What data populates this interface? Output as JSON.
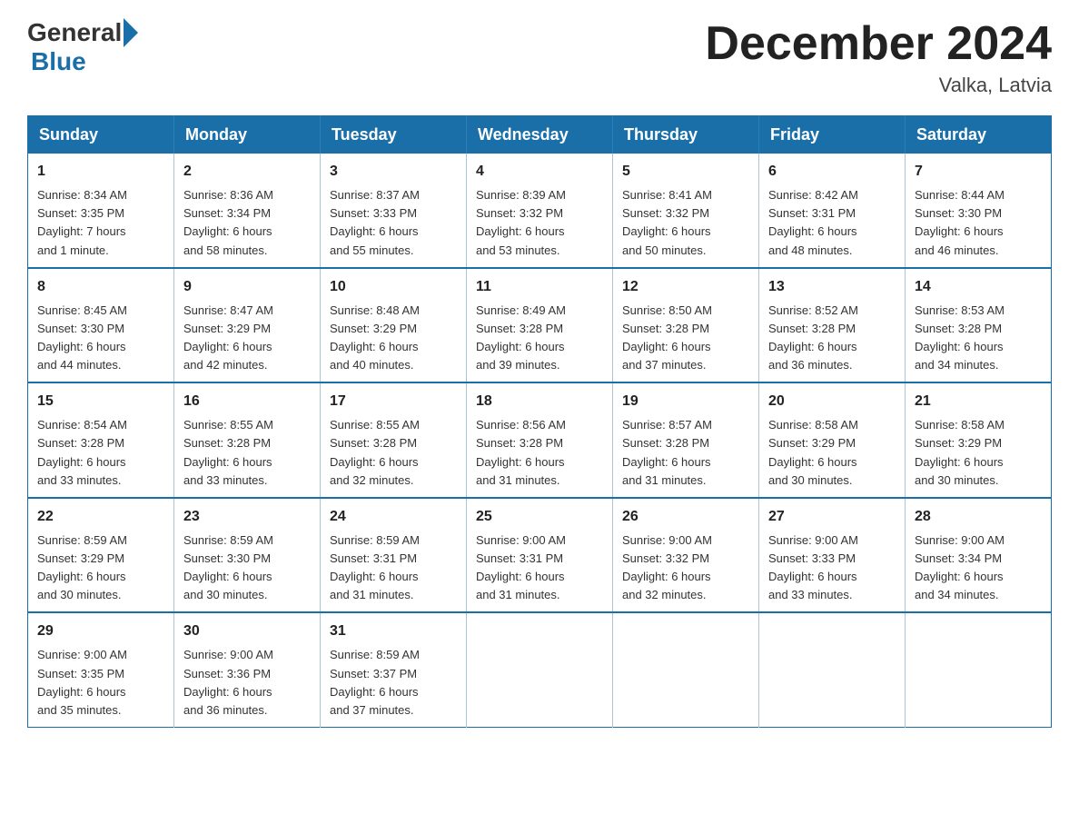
{
  "header": {
    "logo_general": "General",
    "logo_blue": "Blue",
    "month_title": "December 2024",
    "location": "Valka, Latvia"
  },
  "calendar": {
    "days_of_week": [
      "Sunday",
      "Monday",
      "Tuesday",
      "Wednesday",
      "Thursday",
      "Friday",
      "Saturday"
    ],
    "weeks": [
      [
        {
          "day": "1",
          "info": "Sunrise: 8:34 AM\nSunset: 3:35 PM\nDaylight: 7 hours\nand 1 minute."
        },
        {
          "day": "2",
          "info": "Sunrise: 8:36 AM\nSunset: 3:34 PM\nDaylight: 6 hours\nand 58 minutes."
        },
        {
          "day": "3",
          "info": "Sunrise: 8:37 AM\nSunset: 3:33 PM\nDaylight: 6 hours\nand 55 minutes."
        },
        {
          "day": "4",
          "info": "Sunrise: 8:39 AM\nSunset: 3:32 PM\nDaylight: 6 hours\nand 53 minutes."
        },
        {
          "day": "5",
          "info": "Sunrise: 8:41 AM\nSunset: 3:32 PM\nDaylight: 6 hours\nand 50 minutes."
        },
        {
          "day": "6",
          "info": "Sunrise: 8:42 AM\nSunset: 3:31 PM\nDaylight: 6 hours\nand 48 minutes."
        },
        {
          "day": "7",
          "info": "Sunrise: 8:44 AM\nSunset: 3:30 PM\nDaylight: 6 hours\nand 46 minutes."
        }
      ],
      [
        {
          "day": "8",
          "info": "Sunrise: 8:45 AM\nSunset: 3:30 PM\nDaylight: 6 hours\nand 44 minutes."
        },
        {
          "day": "9",
          "info": "Sunrise: 8:47 AM\nSunset: 3:29 PM\nDaylight: 6 hours\nand 42 minutes."
        },
        {
          "day": "10",
          "info": "Sunrise: 8:48 AM\nSunset: 3:29 PM\nDaylight: 6 hours\nand 40 minutes."
        },
        {
          "day": "11",
          "info": "Sunrise: 8:49 AM\nSunset: 3:28 PM\nDaylight: 6 hours\nand 39 minutes."
        },
        {
          "day": "12",
          "info": "Sunrise: 8:50 AM\nSunset: 3:28 PM\nDaylight: 6 hours\nand 37 minutes."
        },
        {
          "day": "13",
          "info": "Sunrise: 8:52 AM\nSunset: 3:28 PM\nDaylight: 6 hours\nand 36 minutes."
        },
        {
          "day": "14",
          "info": "Sunrise: 8:53 AM\nSunset: 3:28 PM\nDaylight: 6 hours\nand 34 minutes."
        }
      ],
      [
        {
          "day": "15",
          "info": "Sunrise: 8:54 AM\nSunset: 3:28 PM\nDaylight: 6 hours\nand 33 minutes."
        },
        {
          "day": "16",
          "info": "Sunrise: 8:55 AM\nSunset: 3:28 PM\nDaylight: 6 hours\nand 33 minutes."
        },
        {
          "day": "17",
          "info": "Sunrise: 8:55 AM\nSunset: 3:28 PM\nDaylight: 6 hours\nand 32 minutes."
        },
        {
          "day": "18",
          "info": "Sunrise: 8:56 AM\nSunset: 3:28 PM\nDaylight: 6 hours\nand 31 minutes."
        },
        {
          "day": "19",
          "info": "Sunrise: 8:57 AM\nSunset: 3:28 PM\nDaylight: 6 hours\nand 31 minutes."
        },
        {
          "day": "20",
          "info": "Sunrise: 8:58 AM\nSunset: 3:29 PM\nDaylight: 6 hours\nand 30 minutes."
        },
        {
          "day": "21",
          "info": "Sunrise: 8:58 AM\nSunset: 3:29 PM\nDaylight: 6 hours\nand 30 minutes."
        }
      ],
      [
        {
          "day": "22",
          "info": "Sunrise: 8:59 AM\nSunset: 3:29 PM\nDaylight: 6 hours\nand 30 minutes."
        },
        {
          "day": "23",
          "info": "Sunrise: 8:59 AM\nSunset: 3:30 PM\nDaylight: 6 hours\nand 30 minutes."
        },
        {
          "day": "24",
          "info": "Sunrise: 8:59 AM\nSunset: 3:31 PM\nDaylight: 6 hours\nand 31 minutes."
        },
        {
          "day": "25",
          "info": "Sunrise: 9:00 AM\nSunset: 3:31 PM\nDaylight: 6 hours\nand 31 minutes."
        },
        {
          "day": "26",
          "info": "Sunrise: 9:00 AM\nSunset: 3:32 PM\nDaylight: 6 hours\nand 32 minutes."
        },
        {
          "day": "27",
          "info": "Sunrise: 9:00 AM\nSunset: 3:33 PM\nDaylight: 6 hours\nand 33 minutes."
        },
        {
          "day": "28",
          "info": "Sunrise: 9:00 AM\nSunset: 3:34 PM\nDaylight: 6 hours\nand 34 minutes."
        }
      ],
      [
        {
          "day": "29",
          "info": "Sunrise: 9:00 AM\nSunset: 3:35 PM\nDaylight: 6 hours\nand 35 minutes."
        },
        {
          "day": "30",
          "info": "Sunrise: 9:00 AM\nSunset: 3:36 PM\nDaylight: 6 hours\nand 36 minutes."
        },
        {
          "day": "31",
          "info": "Sunrise: 8:59 AM\nSunset: 3:37 PM\nDaylight: 6 hours\nand 37 minutes."
        },
        {
          "day": "",
          "info": ""
        },
        {
          "day": "",
          "info": ""
        },
        {
          "day": "",
          "info": ""
        },
        {
          "day": "",
          "info": ""
        }
      ]
    ]
  }
}
